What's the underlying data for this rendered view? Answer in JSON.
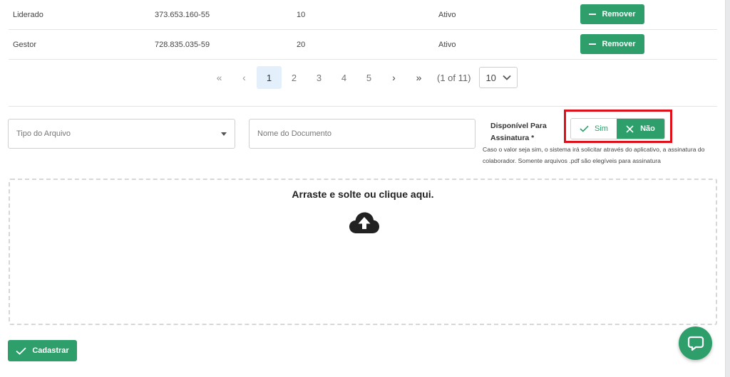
{
  "table": {
    "rows": [
      {
        "col1": "Liderado",
        "col2": "373.653.160-55",
        "col3": "10",
        "col4": "Ativo",
        "action": "Remover"
      },
      {
        "col1": "Gestor",
        "col2": "728.835.035-59",
        "col3": "20",
        "col4": "Ativo",
        "action": "Remover"
      }
    ]
  },
  "pagination": {
    "first": "«",
    "prev": "‹",
    "pages": [
      "1",
      "2",
      "3",
      "4",
      "5"
    ],
    "active_page": "1",
    "next": "›",
    "last": "»",
    "report": "(1 of 11)",
    "rows_per_page": "10"
  },
  "form": {
    "tipo_placeholder": "Tipo do Arquivo",
    "nome_placeholder": "Nome do Documento",
    "assinatura_label": "Disponível Para Assinatura *",
    "toggle_sim": "Sim",
    "toggle_nao": "Não",
    "selected": "Não",
    "help_text": "Caso o valor seja sim, o sistema irá solicitar através do aplicativo, a assinatura do colaborador. Somente arquivos .pdf são elegíveis para assinatura"
  },
  "dropzone": {
    "text": "Arraste e solte ou clique aqui.",
    "icon": "cloud-upload-icon"
  },
  "actions": {
    "cadastrar": "Cadastrar"
  },
  "colors": {
    "primary": "#2e9e6b",
    "highlight": "#e0101a",
    "active_page_bg": "#e3effb"
  }
}
